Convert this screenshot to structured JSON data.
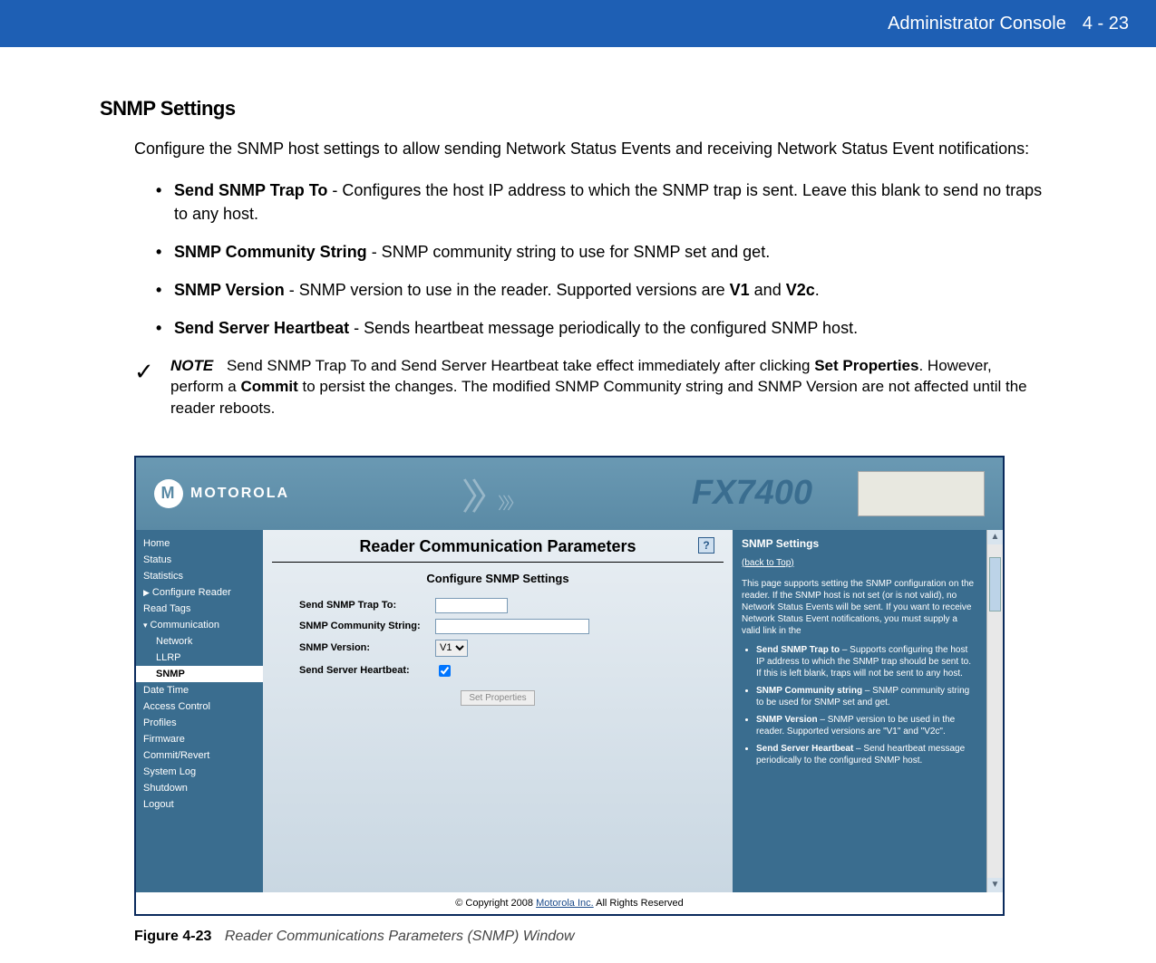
{
  "header": {
    "title": "Administrator Console",
    "page_number": "4 - 23"
  },
  "section_heading": "SNMP Settings",
  "intro": "Configure the SNMP host settings to allow sending Network Status Events and receiving Network Status Event notifications:",
  "bullets": [
    {
      "term": "Send SNMP Trap To",
      "desc": " - Configures the host IP address to which the SNMP trap is sent. Leave this blank to send no traps to any host."
    },
    {
      "term": "SNMP Community String",
      "desc": " - SNMP community string to use for SNMP set and get."
    },
    {
      "term": "SNMP Version",
      "desc_pre": " - SNMP version to use in the reader. Supported versions are ",
      "v1": "V1",
      "and": " and ",
      "v2": "V2c",
      "desc_post": "."
    },
    {
      "term": "Send Server Heartbeat",
      "desc": " - Sends heartbeat message periodically to the configured SNMP host."
    }
  ],
  "note": {
    "label": "NOTE",
    "text_pre": "Send SNMP Trap To and Send Server Heartbeat take effect immediately after clicking ",
    "set_props": "Set Properties",
    "text_mid": ". However, perform a ",
    "commit": "Commit",
    "text_post": " to persist the changes. The modified SNMP Community string and SNMP Version are not affected until the reader reboots."
  },
  "screenshot": {
    "brand": "MOTOROLA",
    "model": "FX7400",
    "sidebar": [
      {
        "label": "Home"
      },
      {
        "label": "Status"
      },
      {
        "label": "Statistics"
      },
      {
        "label": "Configure Reader",
        "arrow": "▶"
      },
      {
        "label": "Read Tags"
      },
      {
        "label": "Communication",
        "arrow": "▾"
      },
      {
        "label": "Network",
        "sub": true
      },
      {
        "label": "LLRP",
        "sub": true
      },
      {
        "label": "SNMP",
        "sub": true,
        "selected": true
      },
      {
        "label": "Date Time"
      },
      {
        "label": "Access Control"
      },
      {
        "label": "Profiles"
      },
      {
        "label": "Firmware"
      },
      {
        "label": "Commit/Revert"
      },
      {
        "label": "System Log"
      },
      {
        "label": "Shutdown"
      },
      {
        "label": "Logout"
      }
    ],
    "main": {
      "title": "Reader Communication Parameters",
      "subheading": "Configure SNMP Settings",
      "help_icon": "?",
      "fields": {
        "trap_label": "Send SNMP Trap To:",
        "trap_value": "",
        "comm_label": "SNMP Community String:",
        "comm_value": "",
        "ver_label": "SNMP Version:",
        "ver_value": "V1",
        "hb_label": "Send Server Heartbeat:",
        "hb_checked": true
      },
      "button": "Set Properties"
    },
    "right_panel": {
      "title": "SNMP Settings",
      "back": "(back to Top)",
      "intro": "This page supports setting the SNMP configuration on the reader. If the SNMP host is not set (or is not valid), no Network Status Events will be sent. If you want to receive Network Status Event notifications, you must supply a valid link in the",
      "items": [
        {
          "b": "Send SNMP Trap to",
          "t": " – Supports configuring the host IP address to which the SNMP trap should be sent to. If this is left blank, traps will not be sent to any host."
        },
        {
          "b": "SNMP Community string",
          "t": " – SNMP community string to be used for SNMP set and get."
        },
        {
          "b": "SNMP Version",
          "t": " – SNMP version to be used in the reader. Supported versions are \"V1\" and \"V2c\"."
        },
        {
          "b": "Send Server Heartbeat",
          "t": " – Send heartbeat message periodically to the configured SNMP host."
        }
      ]
    },
    "footer": {
      "pre": "© Copyright 2008 ",
      "link": "Motorola Inc.",
      "post": " All Rights Reserved"
    }
  },
  "caption": {
    "fig": "Figure 4-23",
    "text": "Reader Communications Parameters (SNMP) Window"
  }
}
